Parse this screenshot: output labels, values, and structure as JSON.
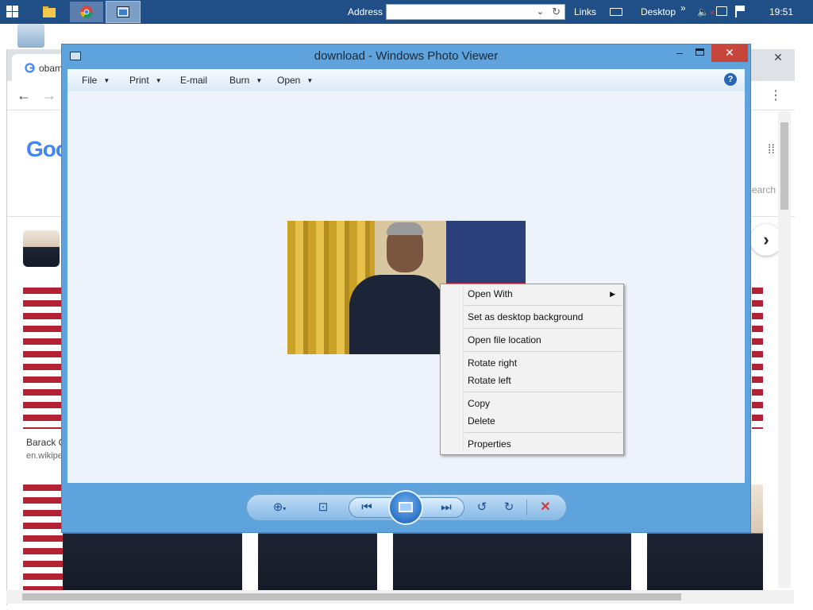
{
  "taskbar": {
    "address_label": "Address",
    "address_value": "",
    "links_label": "Links",
    "desktop_label": "Desktop",
    "overflow_glyph": "»",
    "clock": "19:51"
  },
  "browser": {
    "tab_title": "obam",
    "logo_text": "Goo",
    "result_caption": "Barack O",
    "result_source": "en.wikipe",
    "search_partial": "Search"
  },
  "viewer": {
    "title": "download - Windows Photo Viewer",
    "menu": {
      "file": "File",
      "print": "Print",
      "email": "E-mail",
      "burn": "Burn",
      "open": "Open",
      "help": "?"
    }
  },
  "context_menu": {
    "open_with": "Open With",
    "set_background": "Set as desktop background",
    "open_location": "Open file location",
    "rotate_right": "Rotate right",
    "rotate_left": "Rotate left",
    "copy": "Copy",
    "delete": "Delete",
    "properties": "Properties"
  },
  "colors": {
    "viewer_frame": "#5fa3dd",
    "taskbar": "#1f4f86",
    "close_button": "#c7453a"
  }
}
